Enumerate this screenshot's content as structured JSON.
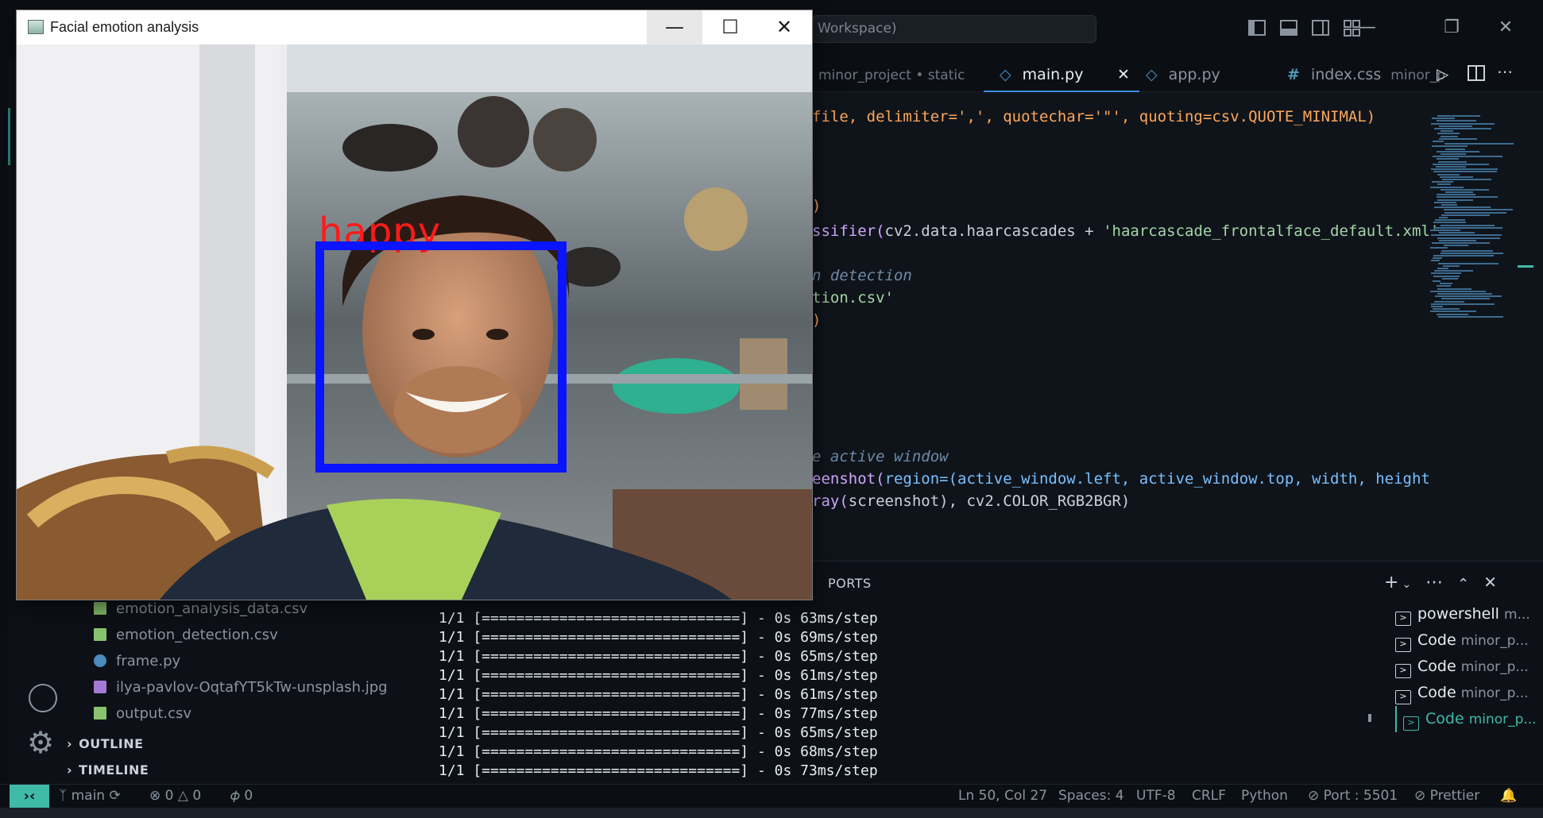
{
  "vscode": {
    "search_text": "Workspace)",
    "tabs": [
      {
        "label": "minor_project • static",
        "type": "breadcrumb"
      },
      {
        "label": "main.py",
        "active": true
      },
      {
        "label": "app.py"
      },
      {
        "label": "index.css",
        "suffix": "minor_p"
      }
    ],
    "code": [
      {
        "text": "file, delimiter=',', quotechar='\"', quoting=csv.QUOTE_MINIMAL)"
      },
      {
        "text": ")"
      },
      {
        "a": "ssifier(",
        "b": "cv2.data.haarcascades",
        "c": " + ",
        "d": "'haarcascade_frontalface_default.xml'"
      },
      {
        "text": "n detection"
      },
      {
        "text": "tion.csv'"
      },
      {
        "text": ")"
      },
      {
        "text": "e active window"
      },
      {
        "a": "eenshot(",
        "b": "region=(active_window.left, active_window.top, width, height"
      },
      {
        "a": "ray(",
        "b": "screenshot), cv2.COLOR_RGB2BGR)"
      }
    ],
    "panel": {
      "tab_label": "PORTS",
      "terminal_lines": [
        "1/1 [==============================] - 0s 63ms/step",
        "1/1 [==============================] - 0s 69ms/step",
        "1/1 [==============================] - 0s 65ms/step",
        "1/1 [==============================] - 0s 61ms/step",
        "1/1 [==============================] - 0s 61ms/step",
        "1/1 [==============================] - 0s 77ms/step",
        "1/1 [==============================] - 0s 65ms/step",
        "1/1 [==============================] - 0s 68ms/step",
        "1/1 [==============================] - 0s 73ms/step"
      ],
      "terminals": [
        {
          "name": "powershell",
          "sub": "m..."
        },
        {
          "name": "Code",
          "sub": "minor_p..."
        },
        {
          "name": "Code",
          "sub": "minor_p..."
        },
        {
          "name": "Code",
          "sub": "minor_p..."
        },
        {
          "name": "Code",
          "sub": "minor_p...",
          "active": true
        }
      ]
    },
    "explorer": {
      "files": [
        {
          "name": "emotion_analysis_data.csv",
          "type": "csv"
        },
        {
          "name": "emotion_detection.csv",
          "type": "csv"
        },
        {
          "name": "frame.py",
          "type": "py"
        },
        {
          "name": "ilya-pavlov-OqtafYT5kTw-unsplash.jpg",
          "type": "jpg"
        },
        {
          "name": "output.csv",
          "type": "csv"
        }
      ],
      "sections": [
        "OUTLINE",
        "TIMELINE"
      ]
    },
    "status": {
      "branch": "main",
      "errors": "0",
      "warnings": "0",
      "ports": "0",
      "cursor": "Ln 50, Col 27",
      "spaces": "Spaces: 4",
      "encoding": "UTF-8",
      "eol": "CRLF",
      "language": "Python",
      "port": "Port : 5501",
      "formatter": "Prettier"
    }
  },
  "app_window": {
    "title": "Facial emotion analysis",
    "emotion": "happy",
    "box_color": "#0a14ff",
    "label_color": "#ff1a1a"
  },
  "colors": {
    "accent": "#3fb9a8",
    "editor_bg": "#0f141b"
  }
}
